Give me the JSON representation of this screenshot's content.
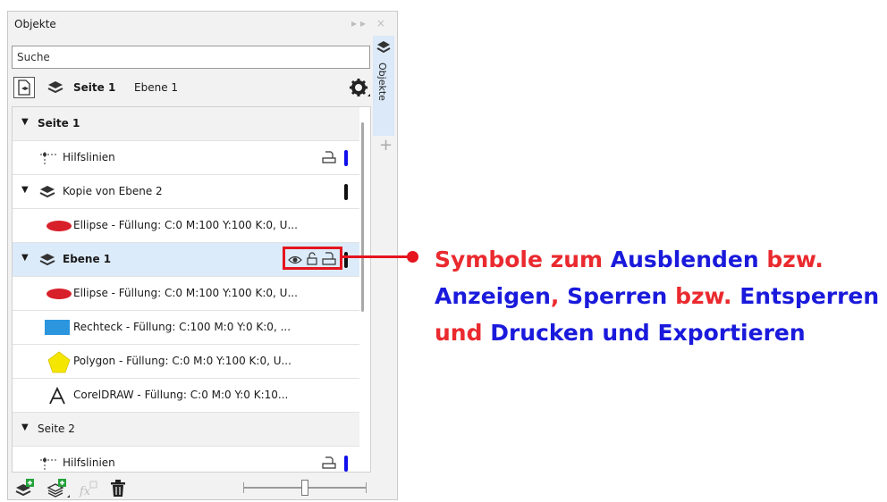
{
  "panel": {
    "title": "Objekte",
    "controls": "▸▸ ×"
  },
  "search": {
    "placeholder": "Suche"
  },
  "header": {
    "page": "Seite 1",
    "layer": "Ebene 1"
  },
  "tab": {
    "label": "Objekte",
    "add": "+"
  },
  "rows": [
    {
      "label": "Seite 1"
    },
    {
      "label": "Hilfslinien"
    },
    {
      "label": "Kopie von Ebene 2"
    },
    {
      "label": "Ellipse - Füllung: C:0 M:100 Y:100 K:0, U..."
    },
    {
      "label": "Ebene 1"
    },
    {
      "label": "Ellipse - Füllung: C:0 M:100 Y:100 K:0, U..."
    },
    {
      "label": "Rechteck - Füllung: C:100 M:0 Y:0 K:0, ..."
    },
    {
      "label": "Polygon - Füllung: C:0 M:0 Y:100 K:0, U..."
    },
    {
      "label": "CorelDRAW - Füllung: C:0 M:0 Y:0 K:10..."
    },
    {
      "label": "Seite 2"
    },
    {
      "label": "Hilfslinien"
    }
  ],
  "annotation": {
    "line1": [
      "Symbole zum ",
      "Ausblenden",
      " bzw."
    ],
    "line2": [
      "Anzeigen",
      ", ",
      "Sperren",
      " bzw. ",
      "Entsperren"
    ],
    "line3": [
      "und ",
      "Drucken und Exportieren"
    ]
  },
  "colors": {
    "annotation_red": "#ea2a2f",
    "annotation_blue": "#1a1adc",
    "selection": "#dcebfa",
    "guides_marker": "#1010ee"
  },
  "icons": [
    "layers-icon",
    "page-settings-icon",
    "gear-icon",
    "guides-icon",
    "eye-icon",
    "lock-icon",
    "printer-icon",
    "trash-icon"
  ]
}
